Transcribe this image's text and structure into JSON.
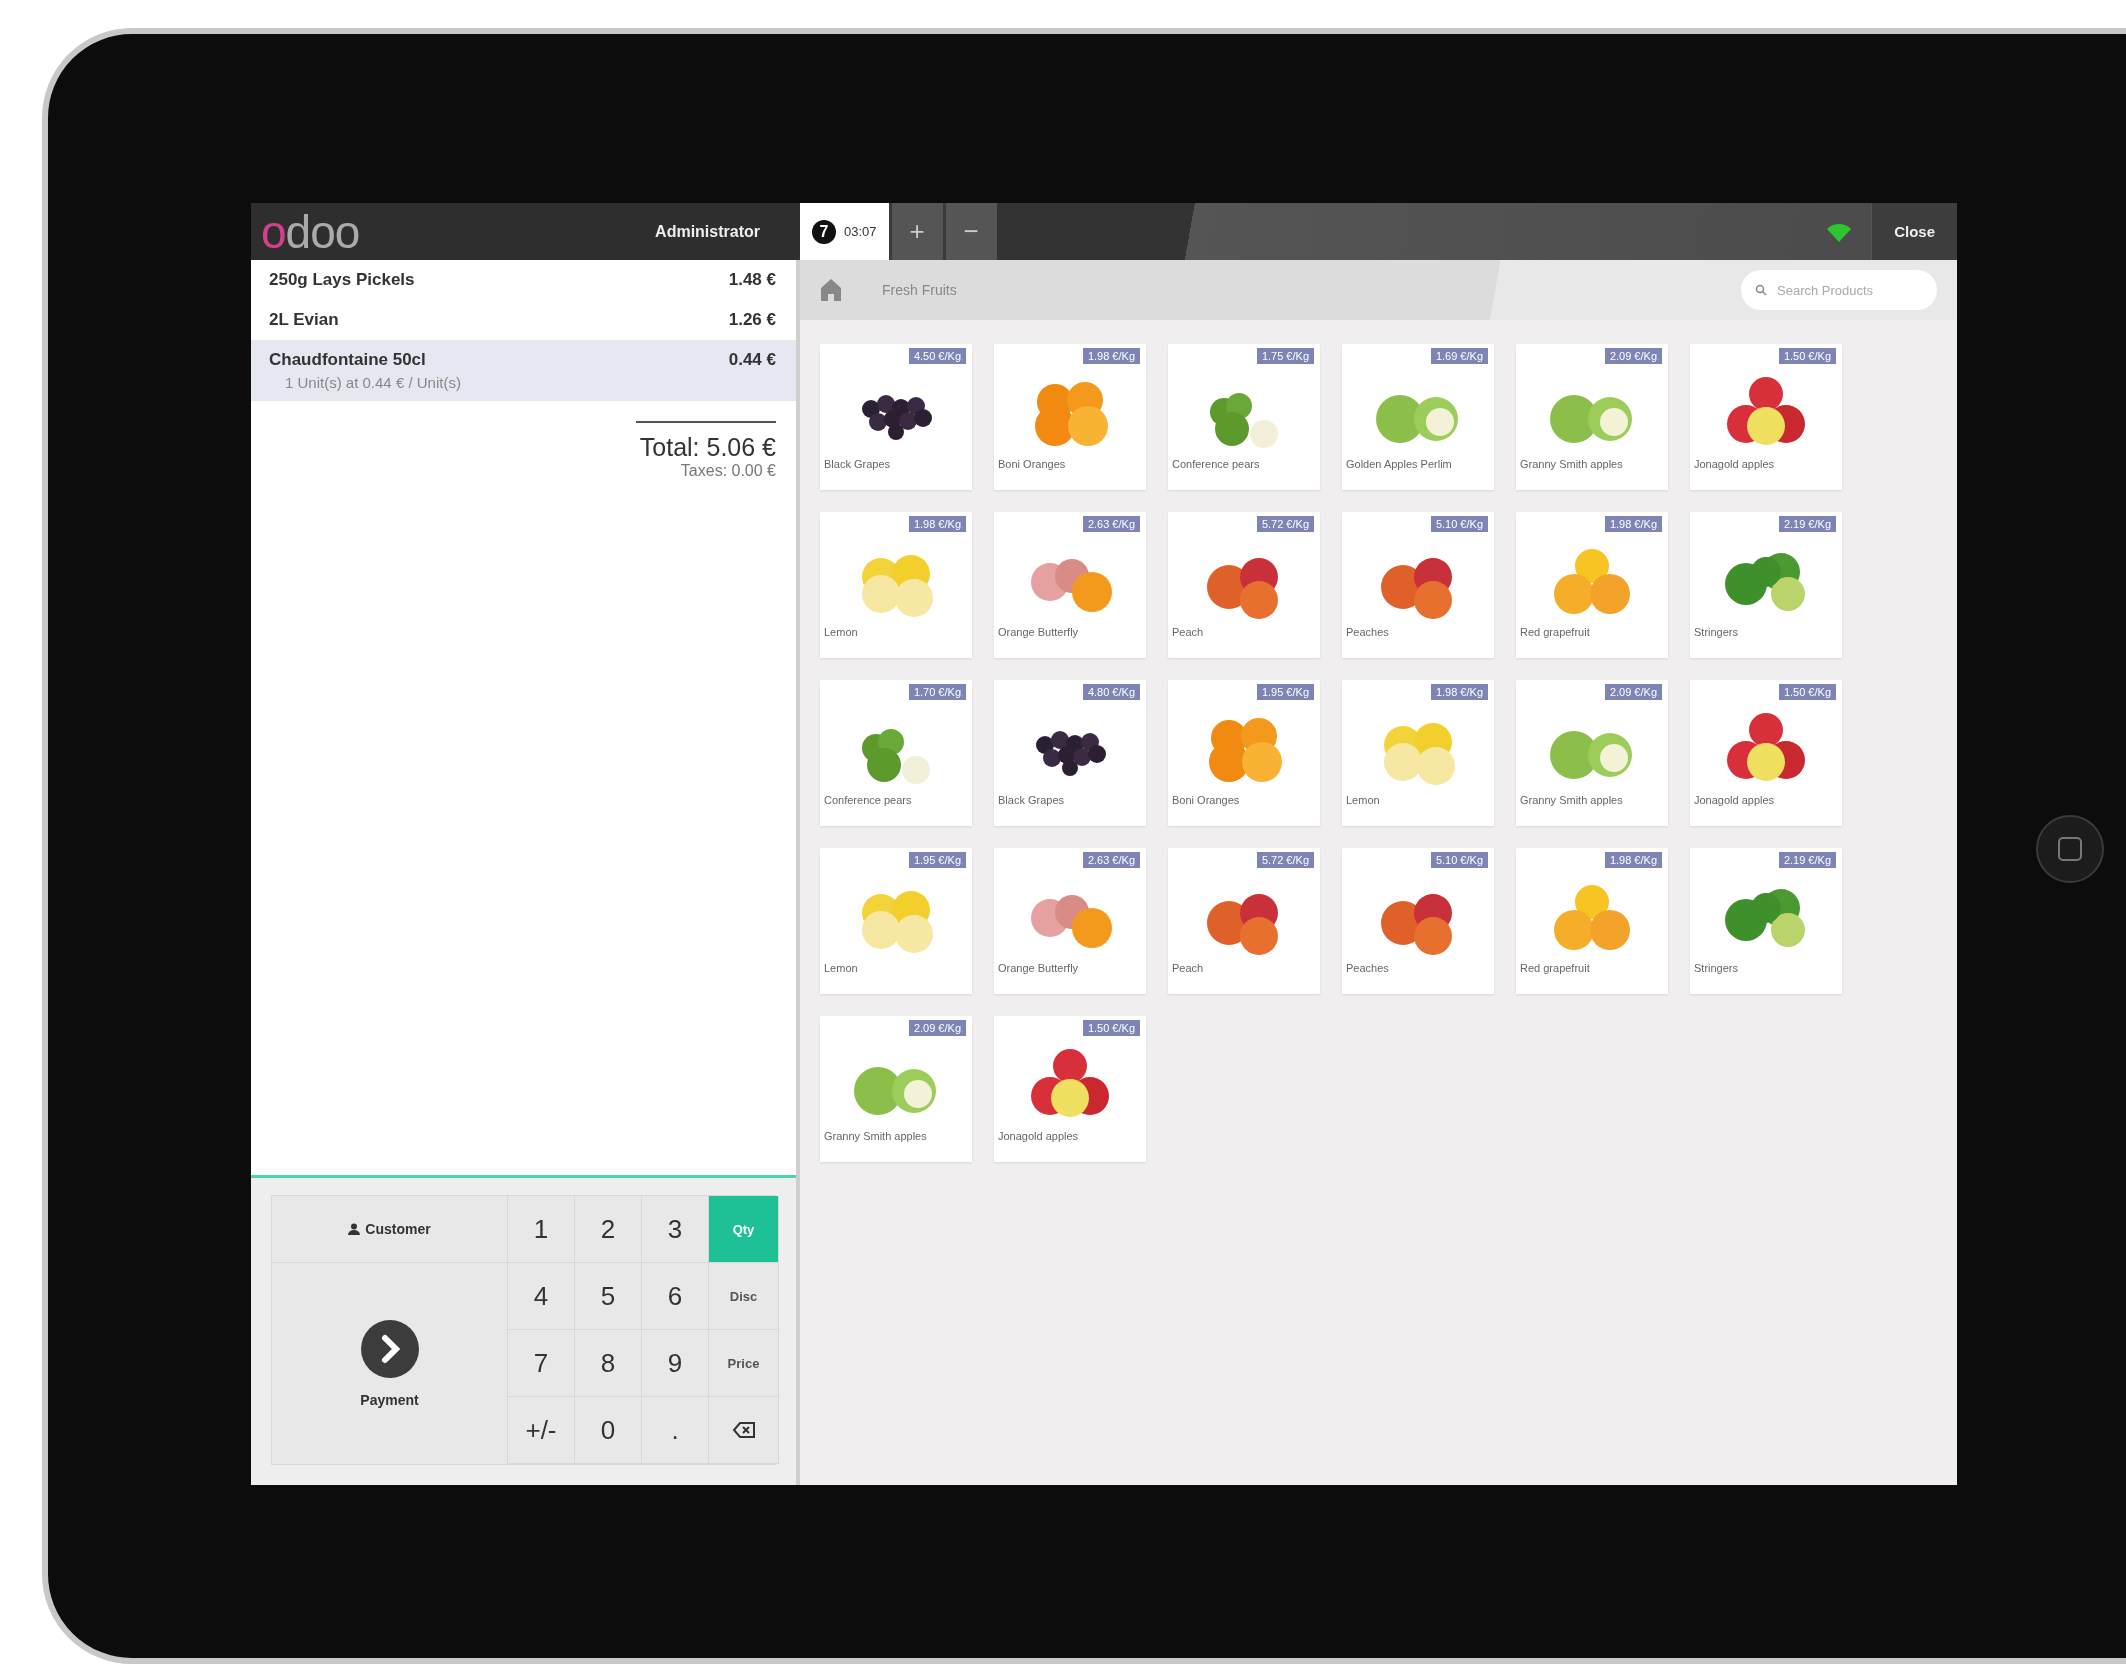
{
  "header": {
    "logo": "odoo",
    "user": "Administrator",
    "orders": [
      {
        "number": "7",
        "time": "03:07",
        "selected": true
      }
    ],
    "add_order": "+",
    "remove_order": "−",
    "close": "Close"
  },
  "breadcrumb": {
    "category": "Fresh Fruits"
  },
  "search": {
    "placeholder": "Search Products"
  },
  "order_lines": [
    {
      "name": "250g Lays Pickels",
      "price": "1.48 €",
      "selected": false
    },
    {
      "name": "2L Evian",
      "price": "1.26 €",
      "selected": false
    },
    {
      "name": "Chaudfontaine 50cl",
      "price": "0.44 €",
      "selected": true,
      "details": "1 Unit(s) at 0.44 € / Unit(s)"
    }
  ],
  "summary": {
    "total": "Total: 5.06 €",
    "taxes": "Taxes: 0.00 €"
  },
  "actions": {
    "customer": "Customer",
    "payment": "Payment"
  },
  "numpad": [
    {
      "kind": "digit",
      "label": "1"
    },
    {
      "kind": "digit",
      "label": "2"
    },
    {
      "kind": "digit",
      "label": "3"
    },
    {
      "kind": "mode",
      "label": "Qty",
      "selected": true
    },
    {
      "kind": "digit",
      "label": "4"
    },
    {
      "kind": "digit",
      "label": "5"
    },
    {
      "kind": "digit",
      "label": "6"
    },
    {
      "kind": "mode",
      "label": "Disc",
      "selected": false
    },
    {
      "kind": "digit",
      "label": "7"
    },
    {
      "kind": "digit",
      "label": "8"
    },
    {
      "kind": "digit",
      "label": "9"
    },
    {
      "kind": "mode",
      "label": "Price",
      "selected": false
    },
    {
      "kind": "digit",
      "label": "+/-"
    },
    {
      "kind": "digit",
      "label": "0"
    },
    {
      "kind": "digit",
      "label": "."
    },
    {
      "kind": "backspace"
    }
  ],
  "products": [
    {
      "name": "Black Grapes",
      "price": "4.50 €/Kg",
      "kind": "grapes"
    },
    {
      "name": "Boni Oranges",
      "price": "1.98 €/Kg",
      "kind": "orange"
    },
    {
      "name": "Conference pears",
      "price": "1.75 €/Kg",
      "kind": "pear"
    },
    {
      "name": "Golden Apples Perlim",
      "price": "1.69 €/Kg",
      "kind": "apple-green"
    },
    {
      "name": "Granny Smith apples",
      "price": "2.09 €/Kg",
      "kind": "apple-green"
    },
    {
      "name": "Jonagold apples",
      "price": "1.50 €/Kg",
      "kind": "apple-red"
    },
    {
      "name": "Lemon",
      "price": "1.98 €/Kg",
      "kind": "lemon"
    },
    {
      "name": "Orange Butterfly",
      "price": "2.63 €/Kg",
      "kind": "butterfly"
    },
    {
      "name": "Peach",
      "price": "5.72 €/Kg",
      "kind": "peach"
    },
    {
      "name": "Peaches",
      "price": "5.10 €/Kg",
      "kind": "peach"
    },
    {
      "name": "Red grapefruit",
      "price": "1.98 €/Kg",
      "kind": "grapefruit"
    },
    {
      "name": "Stringers",
      "price": "2.19 €/Kg",
      "kind": "lime"
    },
    {
      "name": "Conference pears",
      "price": "1.70 €/Kg",
      "kind": "pear"
    },
    {
      "name": "Black Grapes",
      "price": "4.80 €/Kg",
      "kind": "grapes"
    },
    {
      "name": "Boni Oranges",
      "price": "1.95 €/Kg",
      "kind": "orange"
    },
    {
      "name": "Lemon",
      "price": "1.98 €/Kg",
      "kind": "lemon"
    },
    {
      "name": "Granny Smith apples",
      "price": "2.09 €/Kg",
      "kind": "apple-green"
    },
    {
      "name": "Jonagold apples",
      "price": "1.50 €/Kg",
      "kind": "apple-red"
    },
    {
      "name": "Lemon",
      "price": "1.95 €/Kg",
      "kind": "lemon"
    },
    {
      "name": "Orange Butterfly",
      "price": "2.63 €/Kg",
      "kind": "butterfly"
    },
    {
      "name": "Peach",
      "price": "5.72 €/Kg",
      "kind": "peach"
    },
    {
      "name": "Peaches",
      "price": "5.10 €/Kg",
      "kind": "peach"
    },
    {
      "name": "Red grapefruit",
      "price": "1.98 €/Kg",
      "kind": "grapefruit"
    },
    {
      "name": "Stringers",
      "price": "2.19 €/Kg",
      "kind": "lime"
    },
    {
      "name": "Granny Smith apples",
      "price": "2.09 €/Kg",
      "kind": "apple-green"
    },
    {
      "name": "Jonagold apples",
      "price": "1.50 €/Kg",
      "kind": "apple-red"
    }
  ]
}
